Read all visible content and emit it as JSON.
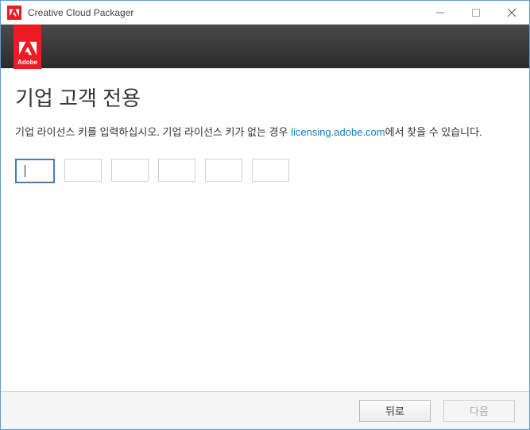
{
  "window": {
    "title": "Creative Cloud Packager"
  },
  "badge": {
    "label": "Adobe"
  },
  "page": {
    "title": "기업 고객 전용",
    "instruction_before": "기업 라이선스 키를 입력하십시오. 기업 라이선스 키가 없는 경우 ",
    "instruction_link": "licensing.adobe.com",
    "instruction_after": "에서 찾을 수 있습니다."
  },
  "license": {
    "fields": [
      "",
      "",
      "",
      "",
      "",
      ""
    ]
  },
  "footer": {
    "back_label": "뒤로",
    "next_label": "다음"
  }
}
